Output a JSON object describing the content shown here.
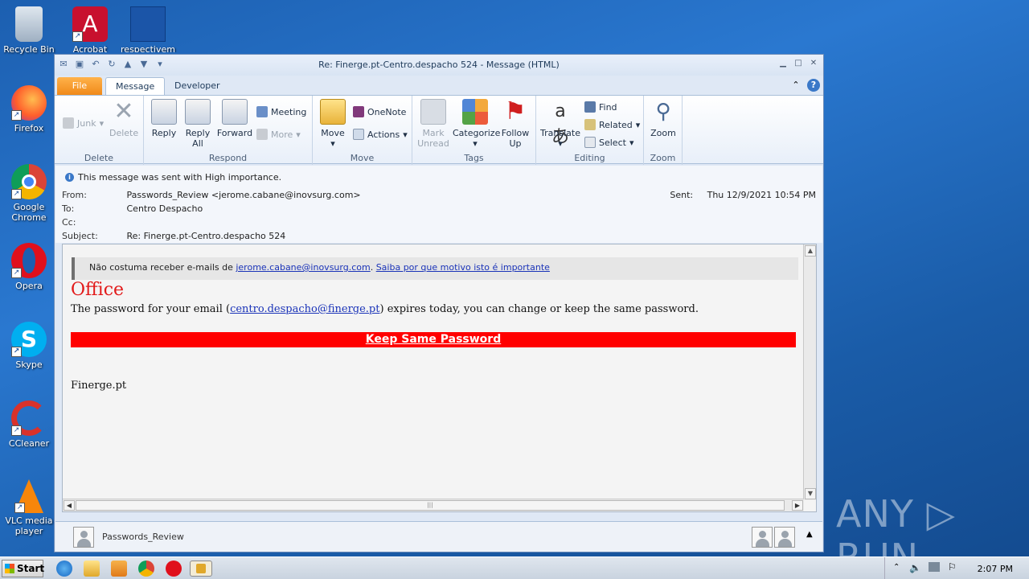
{
  "desktop": {
    "icons": [
      {
        "label": "Recycle Bin"
      },
      {
        "label": "Acrobat"
      },
      {
        "label": "respectivem"
      },
      {
        "label": "Firefox"
      },
      {
        "label": "Google Chrome"
      },
      {
        "label": "Opera"
      },
      {
        "label": "Skype"
      },
      {
        "label": "CCleaner"
      },
      {
        "label": "VLC media player"
      }
    ],
    "watermark": "ANY ▷ RUN"
  },
  "window": {
    "title": "Re: Finerge.pt-Centro.despacho 524  -  Message (HTML)",
    "tabs": {
      "file": "File",
      "message": "Message",
      "developer": "Developer"
    },
    "ribbon": {
      "delete_group": {
        "label": "Delete",
        "junk": "Junk",
        "delete": "Delete"
      },
      "respond_group": {
        "label": "Respond",
        "reply": "Reply",
        "reply_all": "Reply All",
        "forward": "Forward",
        "meeting": "Meeting",
        "more": "More"
      },
      "move_group": {
        "label": "Move",
        "move": "Move",
        "onenote": "OneNote",
        "actions": "Actions"
      },
      "tags_group": {
        "label": "Tags",
        "mark_unread": "Mark Unread",
        "categorize": "Categorize",
        "follow_up": "Follow Up"
      },
      "editing_group": {
        "label": "Editing",
        "translate": "Translate",
        "find": "Find",
        "related": "Related",
        "select": "Select"
      },
      "zoom_group": {
        "label": "Zoom",
        "zoom": "Zoom"
      }
    },
    "header": {
      "importance": "This message was sent with High importance.",
      "from_label": "From:",
      "from_value": "Passwords_Review <jerome.cabane@inovsurg.com>",
      "to_label": "To:",
      "to_value": "Centro Despacho",
      "cc_label": "Cc:",
      "cc_value": "",
      "subject_label": "Subject:",
      "subject_value": "Re: Finerge.pt-Centro.despacho 524",
      "sent_label": "Sent:",
      "sent_value": "Thu 12/9/2021 10:54 PM"
    },
    "body": {
      "banner_text": "Não costuma receber e-mails de ",
      "banner_link1": "jerome.cabane@inovsurg.com",
      "banner_sep": ". ",
      "banner_link2": "Saiba por que motivo isto é importante",
      "office": "Office",
      "para_before": "The password for your email (",
      "para_link": "centro.despacho@finerge.pt",
      "para_after": ") expires today, you can change or keep the same password.",
      "button": "Keep Same Password",
      "signature": "Finerge.pt"
    },
    "people_pane": {
      "name": "Passwords_Review"
    }
  },
  "taskbar": {
    "start": "Start",
    "clock": "2:07 PM"
  },
  "colors": {
    "accent_red": "#ff0000",
    "office_red": "#e21a1a",
    "link": "#1a33b8"
  }
}
